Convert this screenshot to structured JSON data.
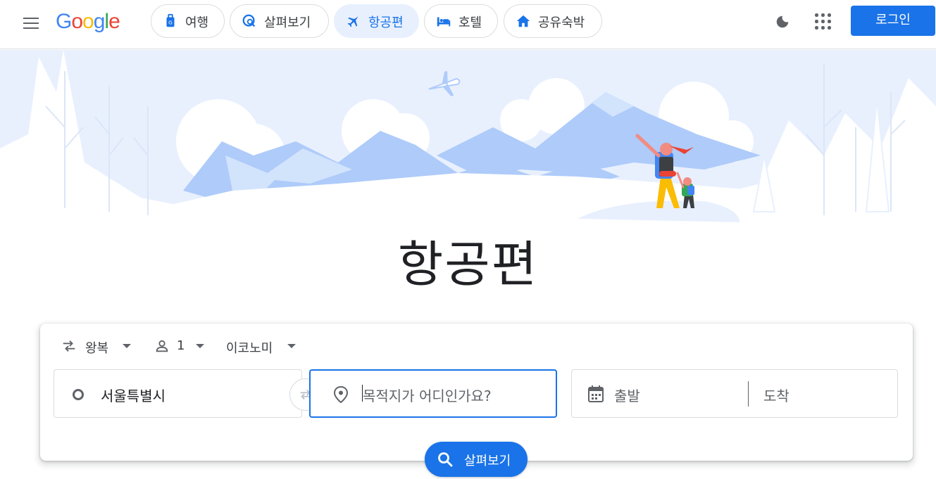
{
  "header": {
    "logo": "Google",
    "tabs": [
      {
        "label": "여행",
        "icon": "travel-bag-icon",
        "active": false
      },
      {
        "label": "살펴보기",
        "icon": "explore-icon",
        "active": false
      },
      {
        "label": "항공편",
        "icon": "flight-icon",
        "active": true
      },
      {
        "label": "호텔",
        "icon": "hotel-bed-icon",
        "active": false
      },
      {
        "label": "공유숙박",
        "icon": "home-icon",
        "active": false
      }
    ],
    "login_label": "로그인"
  },
  "page_title": "항공편",
  "search_card": {
    "trip_type": "왕복",
    "passengers": "1",
    "cabin_class": "이코노미",
    "origin_value": "서울특별시",
    "destination_placeholder": "목적지가 어디인가요?",
    "departure_placeholder": "출발",
    "return_placeholder": "도착",
    "search_label": "살펴보기"
  },
  "colors": {
    "accent": "#1a73e8",
    "active_chip_bg": "#e8f0fe",
    "border": "#dadce0",
    "sky": "#e8f0fe",
    "mountain": "#aecbfa"
  }
}
